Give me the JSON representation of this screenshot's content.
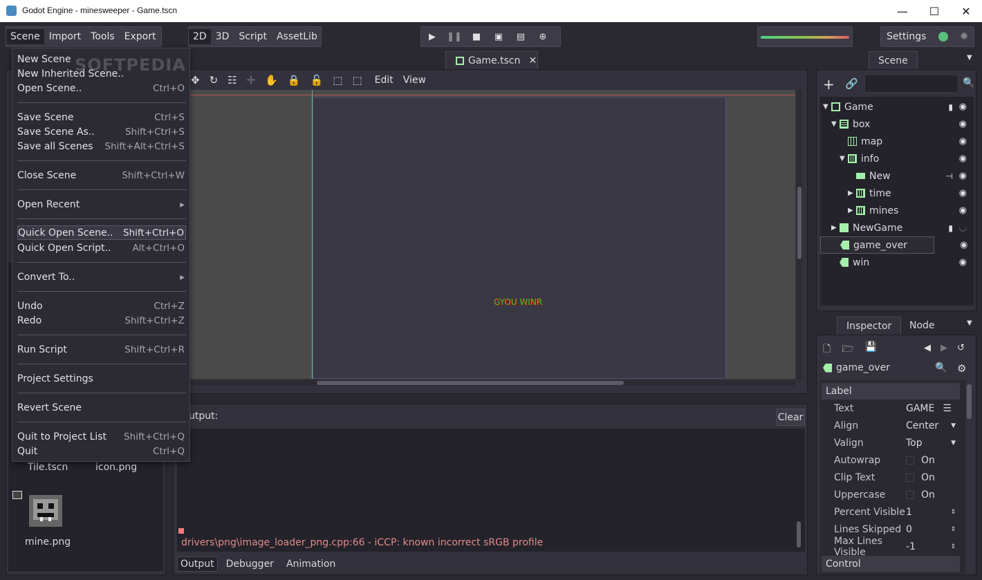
{
  "window": {
    "title": "Godot Engine - minesweeper - Game.tscn",
    "minimize": "—",
    "maximize": "☐",
    "close": "✕"
  },
  "menubar": [
    "Scene",
    "Import",
    "Tools",
    "Export"
  ],
  "workspaces": [
    "2D",
    "3D",
    "Script",
    "AssetLib"
  ],
  "settings_label": "Settings",
  "editor_tab": "Game.tscn",
  "canvas_menu": {
    "edit": "Edit",
    "view": "View"
  },
  "canvas_text": "GYOU WINR",
  "scene_menu": [
    {
      "label": "New Scene",
      "shortcut": ""
    },
    {
      "label": "New Inherited Scene..",
      "shortcut": ""
    },
    {
      "label": "Open Scene..",
      "shortcut": "Ctrl+O"
    },
    {
      "label": "Save Scene",
      "shortcut": "Ctrl+S"
    },
    {
      "label": "Save Scene As..",
      "shortcut": "Shift+Ctrl+S"
    },
    {
      "label": "Save all Scenes",
      "shortcut": "Shift+Alt+Ctrl+S"
    },
    {
      "label": "Close Scene",
      "shortcut": "Shift+Ctrl+W"
    },
    {
      "label": "Open Recent",
      "shortcut": "▸"
    },
    {
      "label": "Quick Open Scene..",
      "shortcut": "Shift+Ctrl+O"
    },
    {
      "label": "Quick Open Script..",
      "shortcut": "Alt+Ctrl+O"
    },
    {
      "label": "Convert To..",
      "shortcut": "▸"
    },
    {
      "label": "Undo",
      "shortcut": "Ctrl+Z"
    },
    {
      "label": "Redo",
      "shortcut": "Shift+Ctrl+Z"
    },
    {
      "label": "Run Script",
      "shortcut": "Shift+Ctrl+R"
    },
    {
      "label": "Project Settings",
      "shortcut": ""
    },
    {
      "label": "Revert Scene",
      "shortcut": ""
    },
    {
      "label": "Quit to Project List",
      "shortcut": "Shift+Ctrl+Q"
    },
    {
      "label": "Quit",
      "shortcut": "Ctrl+Q"
    }
  ],
  "watermark": "SOFTPEDIA",
  "filesystem": {
    "tile": "Tile.tscn",
    "icon": "icon.png",
    "mine": "mine.png"
  },
  "output": {
    "label": "Output:",
    "clear": "Clear",
    "log": "drivers\\png\\image_loader_png.cpp:66 - iCCP: known incorrect sRGB profile",
    "tabs": [
      "Output",
      "Debugger",
      "Animation"
    ]
  },
  "scene_dock": {
    "tab": "Scene",
    "tree": [
      {
        "name": "Game"
      },
      {
        "name": "box"
      },
      {
        "name": "map"
      },
      {
        "name": "info"
      },
      {
        "name": "New"
      },
      {
        "name": "time"
      },
      {
        "name": "mines"
      },
      {
        "name": "NewGame"
      },
      {
        "name": "game_over"
      },
      {
        "name": "win"
      }
    ]
  },
  "inspector": {
    "tabs": [
      "Inspector",
      "Node"
    ],
    "node_name": "game_over",
    "section": "Label",
    "section2": "Control",
    "props": [
      {
        "name": "Text",
        "value": "GAME"
      },
      {
        "name": "Align",
        "value": "Center"
      },
      {
        "name": "Valign",
        "value": "Top"
      },
      {
        "name": "Autowrap",
        "value": "On"
      },
      {
        "name": "Clip Text",
        "value": "On"
      },
      {
        "name": "Uppercase",
        "value": "On"
      },
      {
        "name": "Percent Visible",
        "value": "1"
      },
      {
        "name": "Lines Skipped",
        "value": "0"
      },
      {
        "name": "Max Lines Visible",
        "value": "-1"
      }
    ]
  }
}
